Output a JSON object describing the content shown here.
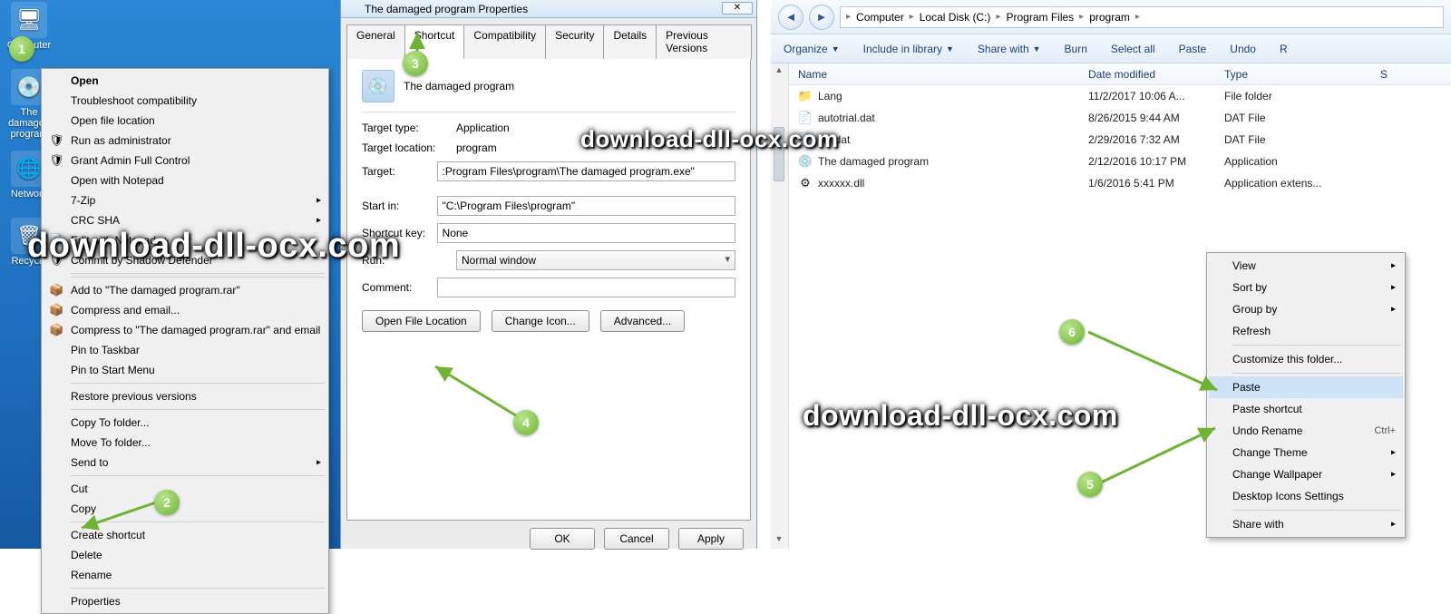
{
  "watermark": "download-dll-ocx.com",
  "desktop": {
    "icons": [
      {
        "label": "Computer",
        "glyph": "🖥"
      },
      {
        "label": "The damaged program",
        "glyph": "💿"
      },
      {
        "label": "Network",
        "glyph": "🌐"
      },
      {
        "label": "Recycle",
        "glyph": "🗑"
      }
    ],
    "context_menu": [
      {
        "label": "Open",
        "bold": true
      },
      {
        "label": "Troubleshoot compatibility"
      },
      {
        "label": "Open file location"
      },
      {
        "label": "Run as administrator",
        "icon": "🛡"
      },
      {
        "label": "Grant Admin Full Control",
        "icon": "🛡"
      },
      {
        "label": "Open with Notepad"
      },
      {
        "label": "7-Zip",
        "submenu": true
      },
      {
        "label": "CRC SHA",
        "submenu": true
      },
      {
        "label": "Edit with Notepad++",
        "icon": "📄"
      },
      {
        "label": "Commit by Shadow Defender",
        "icon": "🛡"
      },
      {
        "sep": true
      },
      {
        "sep": true
      },
      {
        "label": "Add to \"The damaged program.rar\"",
        "icon": "📦"
      },
      {
        "label": "Compress and email...",
        "icon": "📦"
      },
      {
        "label": "Compress to \"The damaged program.rar\" and email",
        "icon": "📦"
      },
      {
        "label": "Pin to Taskbar"
      },
      {
        "label": "Pin to Start Menu"
      },
      {
        "sep": true
      },
      {
        "label": "Restore previous versions"
      },
      {
        "sep": true
      },
      {
        "label": "Copy To folder..."
      },
      {
        "label": "Move To folder..."
      },
      {
        "label": "Send to",
        "submenu": true
      },
      {
        "sep": true
      },
      {
        "label": "Cut"
      },
      {
        "label": "Copy"
      },
      {
        "sep": true
      },
      {
        "label": "Create shortcut"
      },
      {
        "label": "Delete"
      },
      {
        "label": "Rename"
      },
      {
        "sep": true
      },
      {
        "label": "Properties"
      }
    ]
  },
  "properties": {
    "title": "The damaged program Properties",
    "tabs": [
      "General",
      "Shortcut",
      "Compatibility",
      "Security",
      "Details",
      "Previous Versions"
    ],
    "active_tab": "Shortcut",
    "program_name": "The damaged program",
    "fields": {
      "target_type_label": "Target type:",
      "target_type": "Application",
      "target_location_label": "Target location:",
      "target_location": "program",
      "target_label": "Target:",
      "target": ":Program Files\\program\\The damaged program.exe\"",
      "start_in_label": "Start in:",
      "start_in": "\"C:\\Program Files\\program\"",
      "shortcut_key_label": "Shortcut key:",
      "shortcut_key": "None",
      "run_label": "Run:",
      "run": "Normal window",
      "comment_label": "Comment:",
      "comment": ""
    },
    "buttons": {
      "open_location": "Open File Location",
      "change_icon": "Change Icon...",
      "advanced": "Advanced...",
      "ok": "OK",
      "cancel": "Cancel",
      "apply": "Apply"
    }
  },
  "explorer": {
    "breadcrumb": [
      "Computer",
      "Local Disk (C:)",
      "Program Files",
      "program"
    ],
    "commands": {
      "organize": "Organize",
      "include": "Include in library",
      "share": "Share with",
      "burn": "Burn",
      "select_all": "Select all",
      "paste": "Paste",
      "undo": "Undo",
      "redo": "R"
    },
    "columns": {
      "name": "Name",
      "date": "Date modified",
      "type": "Type",
      "size": "S"
    },
    "rows": [
      {
        "icon": "📁",
        "name": "Lang",
        "date": "11/2/2017 10:06 A...",
        "type": "File folder"
      },
      {
        "icon": "📄",
        "name": "autotrial.dat",
        "date": "8/26/2015 9:44 AM",
        "type": "DAT File"
      },
      {
        "icon": "📄",
        "name": "file.dat",
        "date": "2/29/2016 7:32 AM",
        "type": "DAT File"
      },
      {
        "icon": "💿",
        "name": "The damaged program",
        "date": "2/12/2016 10:17 PM",
        "type": "Application"
      },
      {
        "icon": "⚙",
        "name": "xxxxxx.dll",
        "date": "1/6/2016 5:41 PM",
        "type": "Application extens..."
      }
    ],
    "context_menu": [
      {
        "label": "View",
        "submenu": true
      },
      {
        "label": "Sort by",
        "submenu": true
      },
      {
        "label": "Group by",
        "submenu": true
      },
      {
        "label": "Refresh"
      },
      {
        "sep": true
      },
      {
        "label": "Customize this folder..."
      },
      {
        "sep": true
      },
      {
        "label": "Paste",
        "hi": true
      },
      {
        "label": "Paste shortcut"
      },
      {
        "label": "Undo Rename",
        "accel": "Ctrl+"
      },
      {
        "label": "Change Theme",
        "submenu": true
      },
      {
        "label": "Change Wallpaper",
        "submenu": true
      },
      {
        "label": "Desktop Icons Settings"
      },
      {
        "sep": true
      },
      {
        "label": "Share with",
        "submenu": true
      }
    ]
  },
  "markers": {
    "1": "1",
    "2": "2",
    "3": "3",
    "4": "4",
    "5": "5",
    "6": "6"
  }
}
